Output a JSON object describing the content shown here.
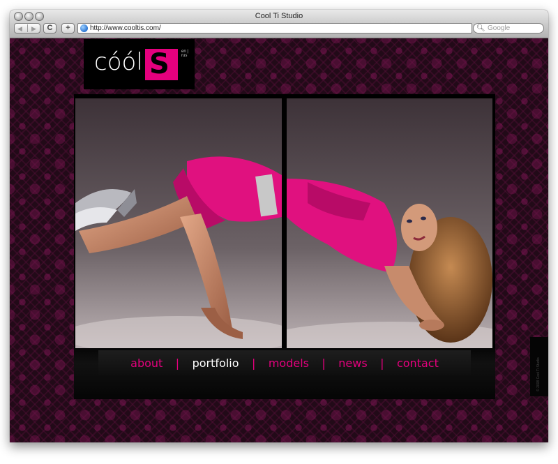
{
  "window": {
    "title": "Cool Ti Studio",
    "url": "http://www.cooltis.com/",
    "search_placeholder": "Google"
  },
  "toolbar": {
    "back_icon": "back-arrow-icon",
    "forward_icon": "forward-arrow-icon",
    "reload_glyph": "C",
    "add_glyph": "+"
  },
  "logo": {
    "text": "cóól",
    "mark_letter": "S",
    "sub": "en | rus"
  },
  "nav": {
    "items": [
      "about",
      "portfolio",
      "models",
      "news",
      "contact"
    ],
    "active": "portfolio",
    "separator": "|"
  },
  "footer": {
    "copyright": "© 2008 Cool Ti Studio"
  },
  "colors": {
    "accent": "#e5007e",
    "background": "#220a18"
  }
}
